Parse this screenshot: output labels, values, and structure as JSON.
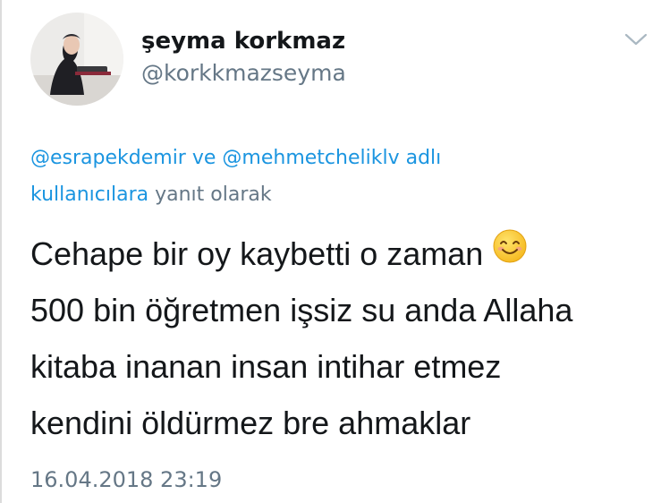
{
  "tweet": {
    "display_name": "şeyma korkmaz",
    "handle": "@korkkmazseyma",
    "reply_mention_1": "@esrapekdemir",
    "reply_connector": "ve",
    "reply_mention_2": "@mehmetcheliklv",
    "reply_mention_2_suffix": "adlı",
    "reply_mention_line2": "kullanıcılara",
    "reply_suffix": "yanıt olarak",
    "body_lines": [
      "Cehape bir oy kaybetti o zaman",
      "500 bin öğretmen işsiz su anda Allaha",
      "kitaba inanan insan intihar etmez",
      "kendini öldürmez bre ahmaklar"
    ],
    "emoji": "smiling-face-icon",
    "timestamp": "16.04.2018 23:19"
  },
  "colors": {
    "link": "#1b95e0",
    "secondary_text": "#657786",
    "primary_text": "#14171a"
  }
}
